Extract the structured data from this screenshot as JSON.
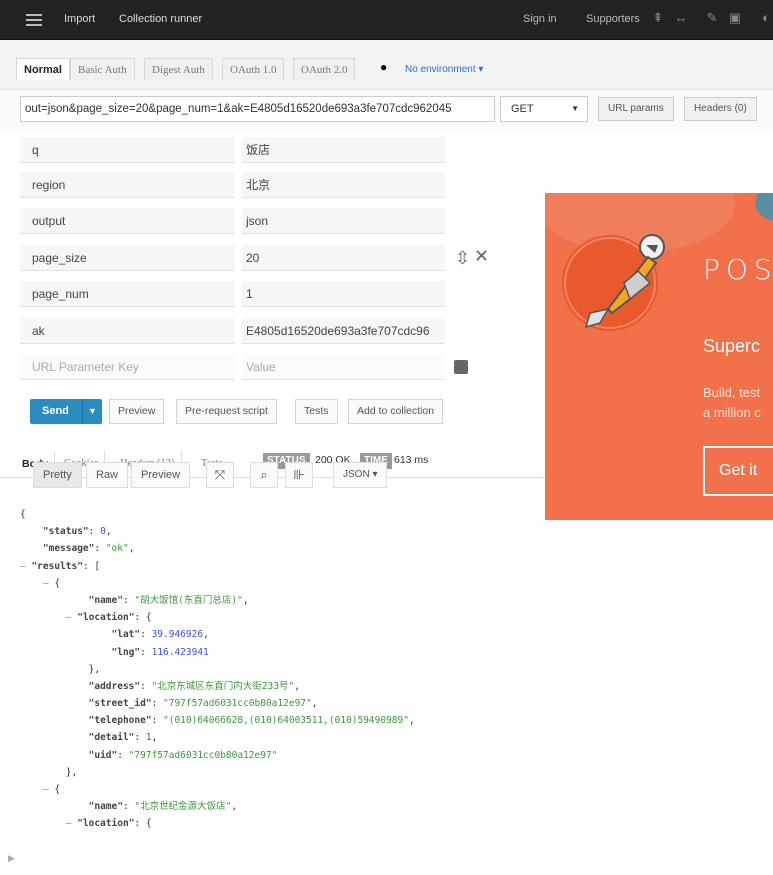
{
  "topbar": {
    "import_label": "Import",
    "collection_runner_label": "Collection runner",
    "sign_in_label": "Sign in",
    "supporters_label": "Supporters"
  },
  "auth_tabs": [
    "Normal",
    "Basic Auth",
    "Digest Auth",
    "OAuth 1.0",
    "OAuth 2.0"
  ],
  "environment": {
    "label": "No environment"
  },
  "request": {
    "url": "out=json&page_size=20&page_num=1&ak=E4805d16520de693a3fe707cdc962045",
    "method": "GET",
    "url_params_label": "URL params",
    "headers_label": "Headers (0)"
  },
  "params": [
    {
      "key": "q",
      "value": "饭店"
    },
    {
      "key": "region",
      "value": "北京"
    },
    {
      "key": "output",
      "value": "json"
    },
    {
      "key": "page_size",
      "value": "20"
    },
    {
      "key": "page_num",
      "value": "1"
    },
    {
      "key": "ak",
      "value": "E4805d16520de693a3fe707cdc96"
    }
  ],
  "param_placeholder": {
    "key": "URL Parameter Key",
    "value": "Value"
  },
  "actions": {
    "send": "Send",
    "preview": "Preview",
    "pre_request_script": "Pre-request script",
    "tests": "Tests",
    "add_to_collection": "Add to collection"
  },
  "response": {
    "tabs": [
      "Body",
      "Cookies",
      "Headers (13)",
      "Tests"
    ],
    "status_badge": "STATUS",
    "status_value": "200 OK",
    "time_badge": "TIME",
    "time_value": "613 ms",
    "view_modes": [
      "Pretty",
      "Raw",
      "Preview"
    ],
    "format": "JSON"
  },
  "json_lines": [
    {
      "indent": 0,
      "text": "{"
    },
    {
      "indent": 1,
      "key": "\"status\"",
      "num": "0",
      "tail": ","
    },
    {
      "indent": 1,
      "key": "\"message\"",
      "str": "\"ok\"",
      "tail": ","
    },
    {
      "indent": 0,
      "toggle": true,
      "key": "\"results\"",
      "tail": ": ["
    },
    {
      "indent": 1,
      "toggle": true,
      "text": "{"
    },
    {
      "indent": 3,
      "key": "\"name\"",
      "str": "\"胡大饭馆(东直门总店)\"",
      "tail": ","
    },
    {
      "indent": 2,
      "toggle": true,
      "key": "\"location\"",
      "tail": ": {"
    },
    {
      "indent": 4,
      "key": "\"lat\"",
      "num": "39.946926",
      "tail": ","
    },
    {
      "indent": 4,
      "key": "\"lng\"",
      "num": "116.423941"
    },
    {
      "indent": 3,
      "text": "},"
    },
    {
      "indent": 3,
      "key": "\"address\"",
      "str": "\"北京东城区东直门内大街233号\"",
      "tail": ","
    },
    {
      "indent": 3,
      "key": "\"street_id\"",
      "str": "\"797f57ad6031cc0b80a12e97\"",
      "tail": ","
    },
    {
      "indent": 3,
      "key": "\"telephone\"",
      "str": "\"(010)64066628,(010)64003511,(010)59490989\"",
      "tail": ","
    },
    {
      "indent": 3,
      "key": "\"detail\"",
      "num": "1",
      "tail": ","
    },
    {
      "indent": 3,
      "key": "\"uid\"",
      "str": "\"797f57ad6031cc0b80a12e97\""
    },
    {
      "indent": 2,
      "text": "},"
    },
    {
      "indent": 1,
      "toggle": true,
      "text": "{"
    },
    {
      "indent": 3,
      "key": "\"name\"",
      "str": "\"北京世纪金源大饭店\"",
      "tail": ","
    },
    {
      "indent": 2,
      "toggle": true,
      "key": "\"location\"",
      "tail": ": {"
    }
  ],
  "banner": {
    "title": "POS",
    "subtitle": "Superc",
    "text_line1": "Build, test",
    "text_line2": "a million c",
    "cta": "Get it"
  },
  "colors": {
    "send": "#2a8bbd",
    "banner": "#f2704a",
    "json_string": "#3a9a3a",
    "json_number": "#3a52d9"
  }
}
